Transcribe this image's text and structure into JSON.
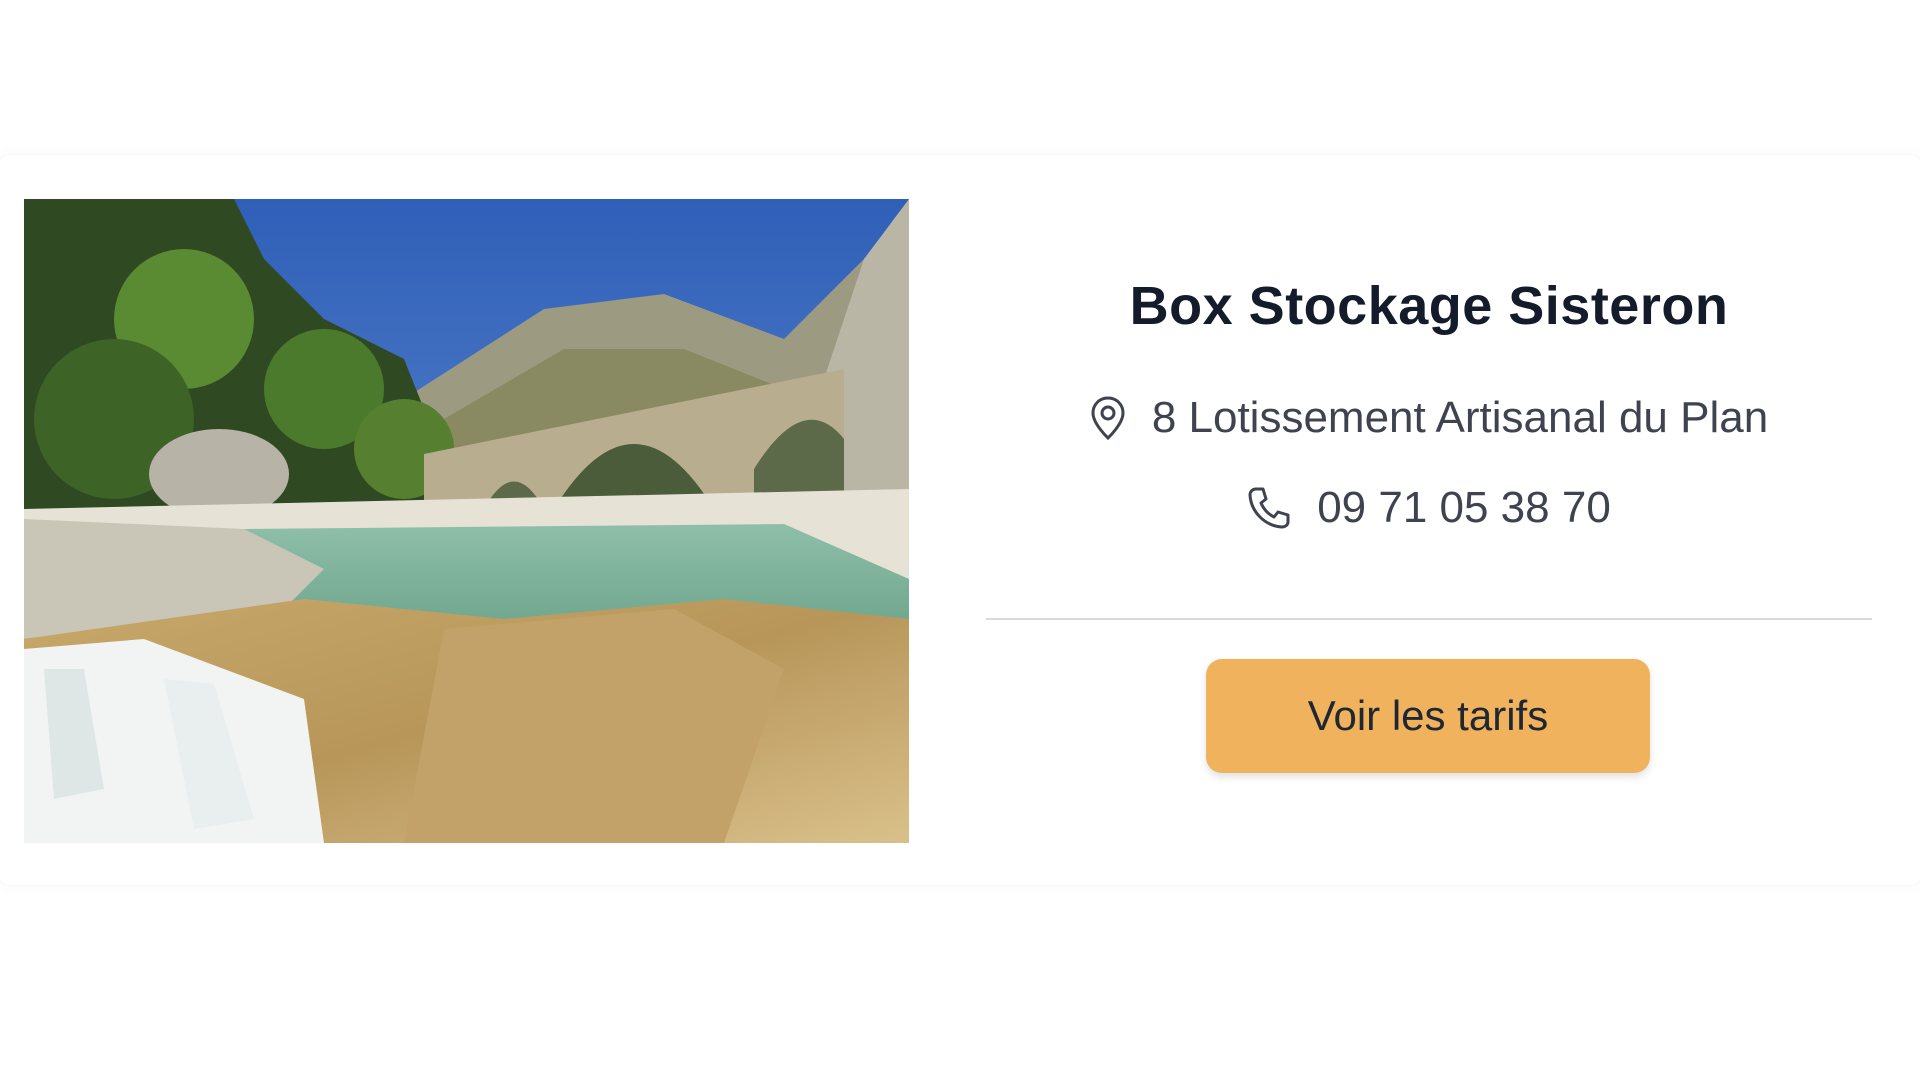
{
  "listing": {
    "title": "Box Stockage Sisteron",
    "address": "8 Lotissement Artisanal du Plan",
    "phone": "09 71 05 38 70",
    "cta_label": "Voir les tarifs",
    "icons": {
      "address": "map-pin-icon",
      "phone": "phone-icon"
    },
    "colors": {
      "cta_background": "#f0b25c",
      "title": "#141c2c",
      "text": "#3f4350"
    }
  }
}
